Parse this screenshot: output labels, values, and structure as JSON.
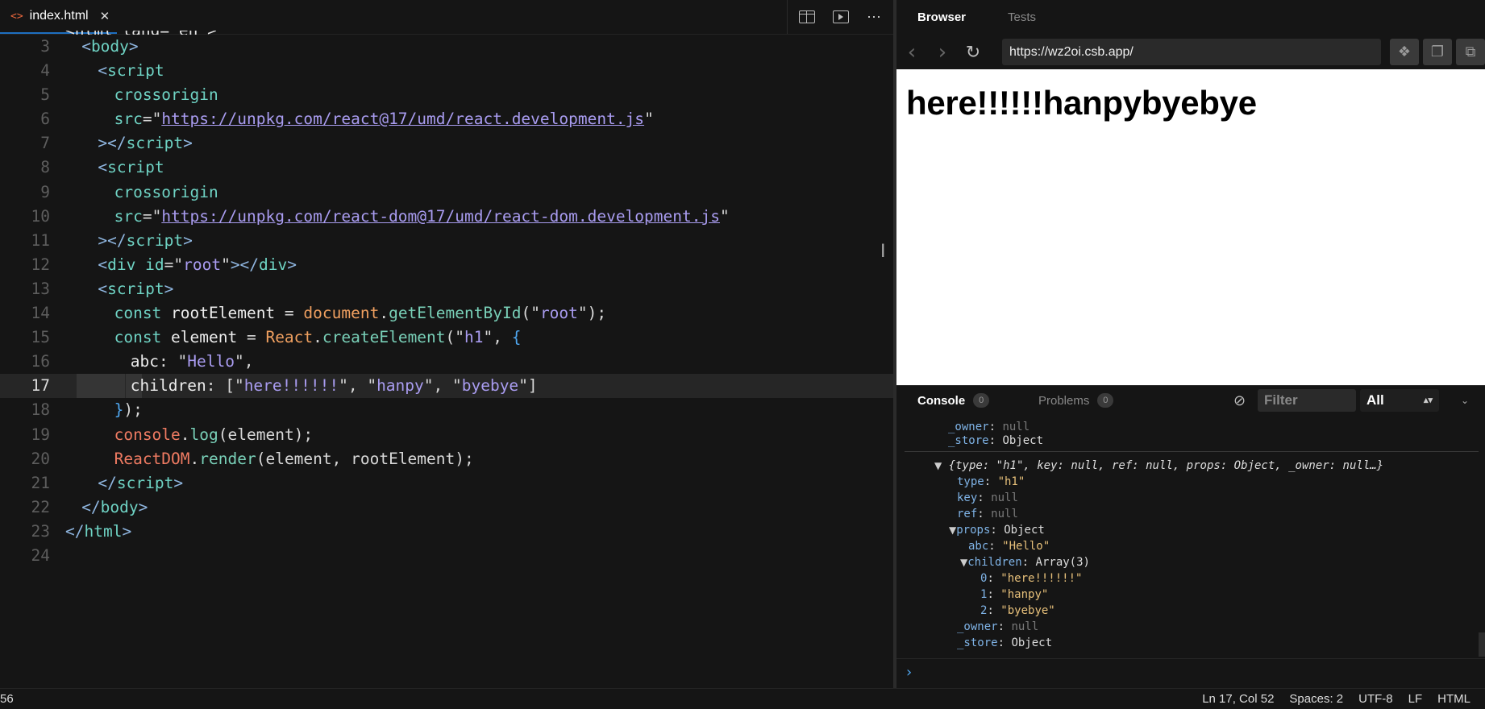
{
  "editor": {
    "tab": {
      "icon": "<>",
      "label": "index.html",
      "close": "✕"
    },
    "actions": {
      "more": "⋯"
    },
    "lines": [
      {
        "n": "",
        "parts": [
          [
            "t-dim",
            "<html lang=\"en\">"
          ]
        ],
        "partial": true
      },
      {
        "n": "3",
        "indent": 1,
        "parts": [
          [
            "t-tag",
            "<"
          ],
          [
            "t-tagname",
            "body"
          ],
          [
            "t-tag",
            ">"
          ]
        ]
      },
      {
        "n": "4",
        "indent": 2,
        "parts": [
          [
            "t-tag",
            "<"
          ],
          [
            "t-tagname",
            "script"
          ]
        ]
      },
      {
        "n": "5",
        "indent": 3,
        "parts": [
          [
            "t-attr",
            "crossorigin"
          ]
        ]
      },
      {
        "n": "6",
        "indent": 3,
        "parts": [
          [
            "t-attr",
            "src"
          ],
          [
            "t-punc",
            "=\""
          ],
          [
            "t-url",
            "https://unpkg.com/react@17/umd/react.development.js"
          ],
          [
            "t-punc",
            "\""
          ]
        ]
      },
      {
        "n": "7",
        "indent": 2,
        "parts": [
          [
            "t-tag",
            "></"
          ],
          [
            "t-tagname",
            "script"
          ],
          [
            "t-tag",
            ">"
          ]
        ]
      },
      {
        "n": "8",
        "indent": 2,
        "parts": [
          [
            "t-tag",
            "<"
          ],
          [
            "t-tagname",
            "script"
          ]
        ]
      },
      {
        "n": "9",
        "indent": 3,
        "parts": [
          [
            "t-attr",
            "crossorigin"
          ]
        ]
      },
      {
        "n": "10",
        "indent": 3,
        "parts": [
          [
            "t-attr",
            "src"
          ],
          [
            "t-punc",
            "=\""
          ],
          [
            "t-url",
            "https://unpkg.com/react-dom@17/umd/react-dom.development.js"
          ],
          [
            "t-punc",
            "\""
          ]
        ]
      },
      {
        "n": "11",
        "indent": 2,
        "parts": [
          [
            "t-tag",
            "></"
          ],
          [
            "t-tagname",
            "script"
          ],
          [
            "t-tag",
            ">"
          ]
        ]
      },
      {
        "n": "12",
        "indent": 2,
        "parts": [
          [
            "t-tag",
            "<"
          ],
          [
            "t-tagname",
            "div"
          ],
          [
            "t-punc",
            " "
          ],
          [
            "t-attr",
            "id"
          ],
          [
            "t-punc",
            "=\""
          ],
          [
            "t-str",
            "root"
          ],
          [
            "t-punc",
            "\""
          ],
          [
            "t-tag",
            "></"
          ],
          [
            "t-tagname",
            "div"
          ],
          [
            "t-tag",
            ">"
          ]
        ]
      },
      {
        "n": "13",
        "indent": 2,
        "parts": [
          [
            "t-tag",
            "<"
          ],
          [
            "t-tagname",
            "script"
          ],
          [
            "t-tag",
            ">"
          ]
        ]
      },
      {
        "n": "14",
        "indent": 3,
        "parts": [
          [
            "t-kw",
            "const"
          ],
          [
            "t-var",
            " rootElement "
          ],
          [
            "t-punc",
            "= "
          ],
          [
            "t-obj",
            "document"
          ],
          [
            "t-punc",
            "."
          ],
          [
            "t-fn",
            "getElementById"
          ],
          [
            "t-punc",
            "(\""
          ],
          [
            "t-str",
            "root"
          ],
          [
            "t-punc",
            "\");"
          ]
        ]
      },
      {
        "n": "15",
        "indent": 3,
        "parts": [
          [
            "t-kw",
            "const"
          ],
          [
            "t-var",
            " element "
          ],
          [
            "t-punc",
            "= "
          ],
          [
            "t-react",
            "React"
          ],
          [
            "t-punc",
            "."
          ],
          [
            "t-fn",
            "createElement"
          ],
          [
            "t-punc",
            "(\""
          ],
          [
            "t-str",
            "h1"
          ],
          [
            "t-punc",
            "\", "
          ],
          [
            "t-brace",
            "{"
          ]
        ]
      },
      {
        "n": "16",
        "indent": 4,
        "parts": [
          [
            "t-var",
            "abc"
          ],
          [
            "t-punc",
            ": \""
          ],
          [
            "t-str",
            "Hello"
          ],
          [
            "t-punc",
            "\","
          ]
        ]
      },
      {
        "n": "17",
        "indent": 4,
        "active": true,
        "parts": [
          [
            "t-var",
            "children"
          ],
          [
            "t-punc",
            ": [\""
          ],
          [
            "t-str",
            "here!!!!!!"
          ],
          [
            "t-punc",
            "\", \""
          ],
          [
            "t-str",
            "hanpy"
          ],
          [
            "t-punc",
            "\", \""
          ],
          [
            "t-str",
            "byebye"
          ],
          [
            "t-punc",
            "\"]"
          ]
        ]
      },
      {
        "n": "18",
        "indent": 3,
        "parts": [
          [
            "t-brace",
            "}"
          ],
          [
            "t-punc",
            ");"
          ]
        ]
      },
      {
        "n": "19",
        "indent": 3,
        "parts": [
          [
            "t-rdom",
            "console"
          ],
          [
            "t-punc",
            "."
          ],
          [
            "t-fn",
            "log"
          ],
          [
            "t-punc",
            "(element);"
          ]
        ]
      },
      {
        "n": "20",
        "indent": 3,
        "parts": [
          [
            "t-rdom",
            "ReactDOM"
          ],
          [
            "t-punc",
            "."
          ],
          [
            "t-fn",
            "render"
          ],
          [
            "t-punc",
            "(element, rootElement);"
          ]
        ]
      },
      {
        "n": "21",
        "indent": 2,
        "parts": [
          [
            "t-tag",
            "</"
          ],
          [
            "t-tagname",
            "script"
          ],
          [
            "t-tag",
            ">"
          ]
        ]
      },
      {
        "n": "22",
        "indent": 1,
        "parts": [
          [
            "t-tag",
            "</"
          ],
          [
            "t-tagname",
            "body"
          ],
          [
            "t-tag",
            ">"
          ]
        ]
      },
      {
        "n": "23",
        "indent": 0,
        "parts": [
          [
            "t-tag",
            "</"
          ],
          [
            "t-tagname",
            "html"
          ],
          [
            "t-tag",
            ">"
          ]
        ]
      },
      {
        "n": "24",
        "indent": 0,
        "parts": []
      }
    ]
  },
  "panel": {
    "tabs": {
      "browser": "Browser",
      "tests": "Tests"
    },
    "nav": {
      "back": "‹",
      "forward": "›",
      "refresh": "↻",
      "url": "https://wz2oi.csb.app/"
    },
    "preview_heading": "here!!!!!!hanpybyebye",
    "console": {
      "console_label": "Console",
      "console_count": "0",
      "problems_label": "Problems",
      "problems_count": "0",
      "filter_placeholder": "Filter",
      "level": "All",
      "prompt": "›"
    }
  },
  "console_output": {
    "prev_owner_key": "_owner",
    "prev_owner_val": "null",
    "prev_store_key": "_store",
    "prev_store_val": "Object",
    "summary": "{type: \"h1\", key: null, ref: null, props: Object, _owner: null…}",
    "type_key": "type",
    "type_val": "\"h1\"",
    "key_key": "key",
    "key_val": "null",
    "ref_key": "ref",
    "ref_val": "null",
    "props_key": "props",
    "props_val": "Object",
    "abc_key": "abc",
    "abc_val": "\"Hello\"",
    "children_key": "children",
    "children_val": "Array(3)",
    "c0_key": "0",
    "c0_val": "\"here!!!!!!\"",
    "c1_key": "1",
    "c1_val": "\"hanpy\"",
    "c2_key": "2",
    "c2_val": "\"byebye\"",
    "owner_key": "_owner",
    "owner_val": "null",
    "store_key": "_store",
    "store_val": "Object"
  },
  "status": {
    "left": "56",
    "position": "Ln 17, Col 52",
    "spaces": "Spaces: 2",
    "encoding": "UTF-8",
    "eol": "LF",
    "language": "HTML"
  }
}
